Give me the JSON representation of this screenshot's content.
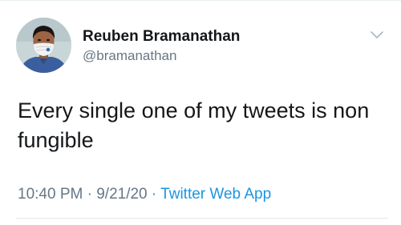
{
  "author": {
    "display_name": "Reuben Bramanathan",
    "handle": "@bramanathan"
  },
  "tweet": {
    "text": "Every single one of my tweets is non fungible",
    "time": "10:40 PM",
    "date": "9/21/20",
    "separator": "·",
    "source": "Twitter Web App"
  },
  "icons": {
    "menu": "chevron-down-icon",
    "avatar": "avatar"
  },
  "colors": {
    "link": "#1b95e0",
    "secondary_text": "#657786",
    "primary_text": "#14171a"
  }
}
